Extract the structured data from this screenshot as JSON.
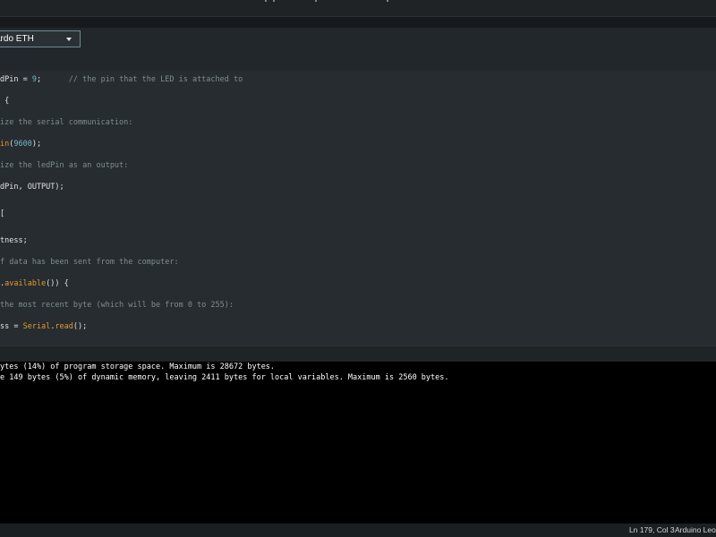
{
  "toolbar": {
    "board_select_label": "ardo ETH"
  },
  "editor": {
    "lines": [
      {
        "segments": [
          {
            "text": "dPin = ",
            "cls": ""
          },
          {
            "text": "9",
            "cls": "tok-num"
          },
          {
            "text": ";      ",
            "cls": ""
          },
          {
            "text": "// the pin that the LED is attached to",
            "cls": "tok-comment"
          }
        ]
      },
      {
        "segments": [
          {
            "text": " {",
            "cls": ""
          }
        ]
      },
      {
        "segments": [
          {
            "text": "ize the serial communication:",
            "cls": "tok-comment"
          }
        ]
      },
      {
        "segments": [
          {
            "text": "in",
            "cls": "tok-kw"
          },
          {
            "text": "(",
            "cls": ""
          },
          {
            "text": "9600",
            "cls": "tok-num"
          },
          {
            "text": ");",
            "cls": ""
          }
        ]
      },
      {
        "segments": [
          {
            "text": "ize the ledPin as an output:",
            "cls": "tok-comment"
          }
        ]
      },
      {
        "segments": [
          {
            "text": "dPin, OUTPUT);",
            "cls": ""
          }
        ]
      },
      {
        "segments": [
          {
            "text": "[",
            "cls": ""
          }
        ]
      },
      {
        "segments": [
          {
            "text": "tness;",
            "cls": ""
          }
        ]
      },
      {
        "segments": [
          {
            "text": "f data has been sent from the computer:",
            "cls": "tok-comment"
          }
        ]
      },
      {
        "segments": [
          {
            "text": ".",
            "cls": ""
          },
          {
            "text": "available",
            "cls": "tok-kw"
          },
          {
            "text": "()) {",
            "cls": ""
          }
        ]
      },
      {
        "segments": [
          {
            "text": "the most recent byte (which will be from 0 to 255):",
            "cls": "tok-comment"
          }
        ]
      },
      {
        "segments": [
          {
            "text": "ss = ",
            "cls": ""
          },
          {
            "text": "Serial",
            "cls": "tok-kw"
          },
          {
            "text": ".",
            "cls": ""
          },
          {
            "text": "read",
            "cls": "tok-kw"
          },
          {
            "text": "();",
            "cls": ""
          }
        ]
      }
    ]
  },
  "console": {
    "lines": [
      "ytes (14%) of program storage space. Maximum is 28672 bytes.",
      "e 149 bytes (5%) of dynamic memory, leaving 2411 bytes for local variables. Maximum is 2560 bytes."
    ]
  },
  "status": {
    "position": "Ln 179, Col 3",
    "board": "Arduino Leon"
  }
}
